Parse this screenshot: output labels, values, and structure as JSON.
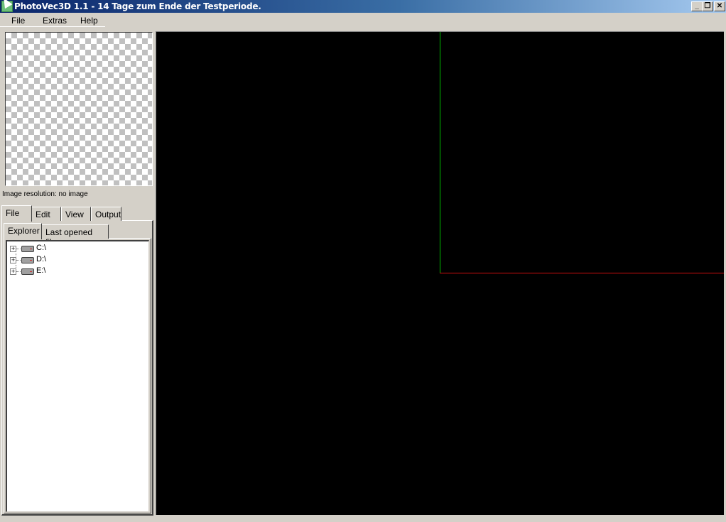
{
  "window": {
    "title": "PhotoVec3D 1.1 - 14 Tage zum Ende der Testperiode.",
    "controls": {
      "minimize": "_",
      "restore": "❐",
      "close": "✕"
    }
  },
  "menubar": {
    "items": [
      {
        "label": "File"
      },
      {
        "label": "Extras"
      },
      {
        "label": "Help"
      }
    ]
  },
  "preview": {
    "resolution_label": "Image resolution: no image"
  },
  "main_tabs": [
    {
      "label": "File",
      "active": true
    },
    {
      "label": "Edit",
      "active": false
    },
    {
      "label": "View",
      "active": false
    },
    {
      "label": "Output",
      "active": false
    }
  ],
  "sub_tabs": [
    {
      "label": "Explorer",
      "active": true
    },
    {
      "label": "Last opened files",
      "active": false
    }
  ],
  "explorer": {
    "drives": [
      {
        "label": "C:\\",
        "icon": "drive-icon",
        "expander": "+"
      },
      {
        "label": "D:\\",
        "icon": "drive-icon",
        "expander": "+"
      },
      {
        "label": "E:\\",
        "icon": "drive-icon",
        "expander": "+"
      }
    ]
  },
  "viewport": {
    "background": "#000000",
    "y_axis_color": "#00c000",
    "x_axis_color": "#d01010"
  }
}
